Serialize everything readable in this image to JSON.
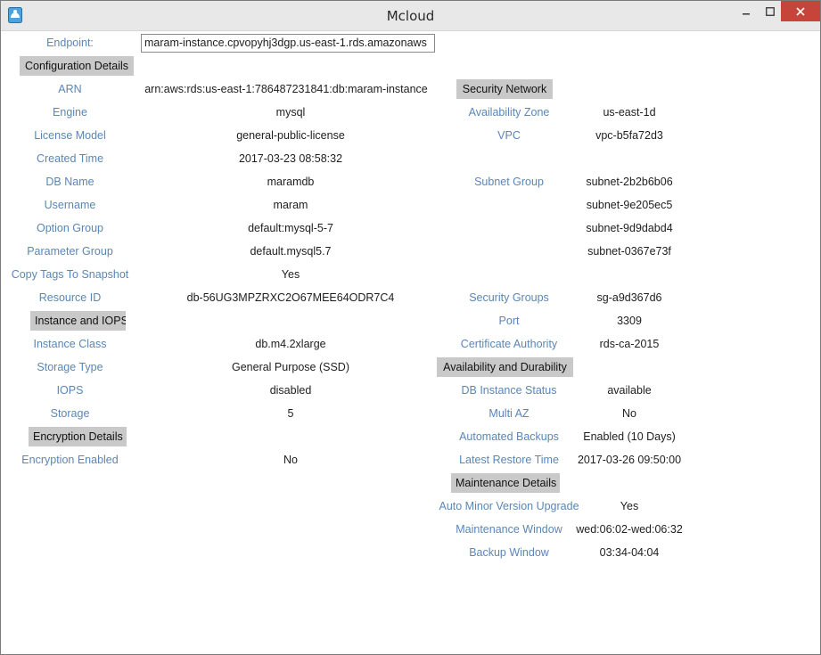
{
  "window": {
    "title": "Mcloud",
    "minimize_glyph": "–",
    "maximize_glyph": "☐",
    "close_glyph": "×",
    "icon": "app-icon"
  },
  "endpoint": {
    "label": "Endpoint:",
    "value": "maram-instance.cpvopyhj3dgp.us-east-1.rds.amazonaws"
  },
  "left": {
    "configuration_header": "Configuration Details",
    "config": [
      {
        "label": "ARN",
        "value": "arn:aws:rds:us-east-1:786487231841:db:maram-instance"
      },
      {
        "label": "Engine",
        "value": "mysql"
      },
      {
        "label": "License Model",
        "value": "general-public-license"
      },
      {
        "label": "Created Time",
        "value": "2017-03-23 08:58:32"
      },
      {
        "label": "DB Name",
        "value": "maramdb"
      },
      {
        "label": "Username",
        "value": "maram"
      },
      {
        "label": "Option Group",
        "value": "default:mysql-5-7"
      },
      {
        "label": "Parameter Group",
        "value": "default.mysql5.7"
      },
      {
        "label": "Copy Tags To Snapshot",
        "value": "Yes"
      },
      {
        "label": "Resource ID",
        "value": "db-56UG3MPZRXC2O67MEE64ODR7C4"
      }
    ],
    "instance_header": "Instance and IOPS",
    "instance": [
      {
        "label": "Instance Class",
        "value": "db.m4.2xlarge"
      },
      {
        "label": "Storage Type",
        "value": "General Purpose (SSD)"
      },
      {
        "label": "IOPS",
        "value": "disabled"
      },
      {
        "label": "Storage",
        "value": "5"
      }
    ],
    "encryption_header": "Encryption Details",
    "encryption": [
      {
        "label": "Encryption Enabled",
        "value": "No"
      }
    ]
  },
  "right": {
    "security_header": "Security Network",
    "security": [
      {
        "label": "Availability Zone",
        "value": "us-east-1d"
      },
      {
        "label": "VPC",
        "value": "vpc-b5fa72d3"
      },
      {
        "label": "Subnet Group",
        "value": "subnet-2b2b6b06"
      },
      {
        "label": "",
        "value": "subnet-9e205ec5"
      },
      {
        "label": "",
        "value": "subnet-9d9dabd4"
      },
      {
        "label": "",
        "value": "subnet-0367e73f"
      },
      {
        "label": "Security Groups",
        "value": "sg-a9d367d6"
      },
      {
        "label": "Port",
        "value": "3309"
      },
      {
        "label": "Certificate Authority",
        "value": "rds-ca-2015"
      }
    ],
    "availability_header": "Availability and Durability",
    "availability": [
      {
        "label": "DB Instance Status",
        "value": "available"
      },
      {
        "label": "Multi AZ",
        "value": "No"
      },
      {
        "label": "Automated Backups",
        "value": "Enabled (10 Days)"
      },
      {
        "label": "Latest Restore Time",
        "value": "2017-03-26 09:50:00"
      }
    ],
    "maintenance_header": "Maintenance Details",
    "maintenance": [
      {
        "label": "Auto Minor Version Upgrade",
        "value": "Yes"
      },
      {
        "label": "Maintenance Window",
        "value": "wed:06:02-wed:06:32"
      },
      {
        "label": "Backup Window",
        "value": "03:34-04:04"
      }
    ]
  },
  "colors": {
    "label": "#5a86b8",
    "value": "#1e1e1e",
    "header_bg": "#c9c9c9",
    "titlebar_bg": "#e8e8e8",
    "close_bg": "#c7443b"
  }
}
